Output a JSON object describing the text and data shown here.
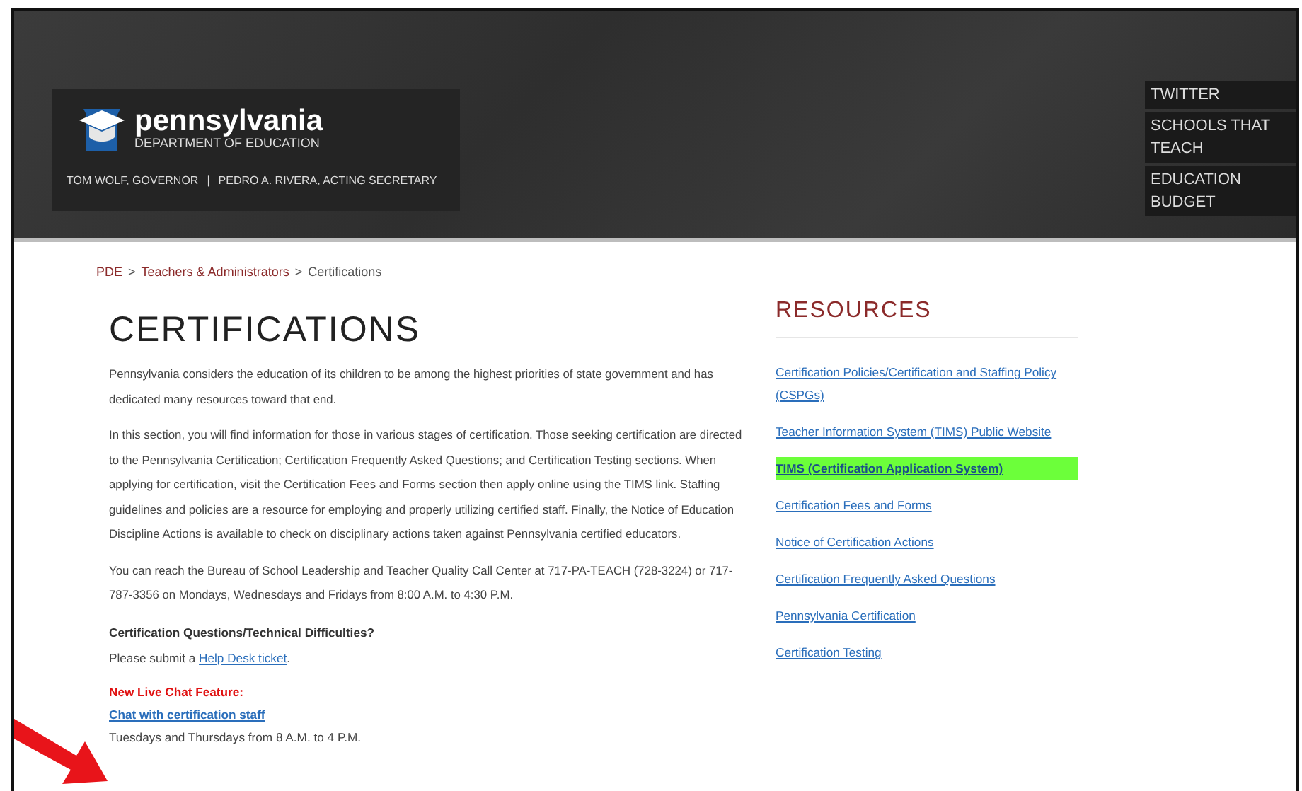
{
  "header": {
    "logo": {
      "name": "pennsylvania",
      "subtitle": "DEPARTMENT OF EDUCATION"
    },
    "officials": [
      "TOM WOLF, GOVERNOR",
      "PEDRO A. RIVERA, ACTING SECRETARY"
    ],
    "separator": "|",
    "nav": [
      "TWITTER",
      "SCHOOLS THAT TEACH",
      "EDUCATION BUDGET"
    ]
  },
  "breadcrumb": {
    "separator": ">",
    "items": [
      {
        "label": "PDE",
        "current": false
      },
      {
        "label": "Teachers & Administrators",
        "current": false
      },
      {
        "label": "Certifications",
        "current": true
      }
    ]
  },
  "main": {
    "title": "CERTIFICATIONS",
    "paragraphs": [
      "Pennsylvania considers the education of its children to be among the highest priorities of state government and has dedicated many resources toward that end.",
      "In this section, you will find information for those in various stages of certification. Those seeking certification are directed to the Pennsylvania Certification; Certification Frequently Asked Questions; and Certification Testing sections.  When applying for certification, visit the Certification Fees and Forms section then apply online using the TIMS link. Staffing guidelines and policies are a resource for employing and properly utilizing certified staff. Finally, the Notice of Education Discipline Actions is available to check on disciplinary actions taken against Pennsylvania certified educators.",
      "You can reach the Bureau of School Leadership and Teacher Quality Call Center at 717-PA-TEACH (728-3224) or 717-787-3356 on Mondays, Wednesdays and Fridays from 8:00 A.M. to 4:30 P.M."
    ],
    "support": {
      "heading": "Certification Questions/Technical Difficulties?",
      "before": "Please submit a ",
      "link": "Help Desk ticket",
      "after": "."
    },
    "chat": {
      "heading": "New Live Chat Feature:",
      "link": "Chat with certification staff",
      "hours": "Tuesdays and Thursdays from 8 A.M. to 4 P.M."
    }
  },
  "resources": {
    "title": "RESOURCES",
    "links": [
      {
        "label": "Certification Policies/Certification and Staffing Policy (CSPGs)",
        "highlighted": false
      },
      {
        "label": "Teacher Information System (TIMS) Public Website",
        "highlighted": false
      },
      {
        "label": "TIMS (Certification Application System)",
        "highlighted": true
      },
      {
        "label": "Certification Fees and Forms",
        "highlighted": false
      },
      {
        "label": "Notice of Certification Actions",
        "highlighted": false
      },
      {
        "label": "Certification Frequently Asked Questions",
        "highlighted": false
      },
      {
        "label": "Pennsylvania Certification",
        "highlighted": false
      },
      {
        "label": "Certification Testing",
        "highlighted": false
      }
    ]
  }
}
